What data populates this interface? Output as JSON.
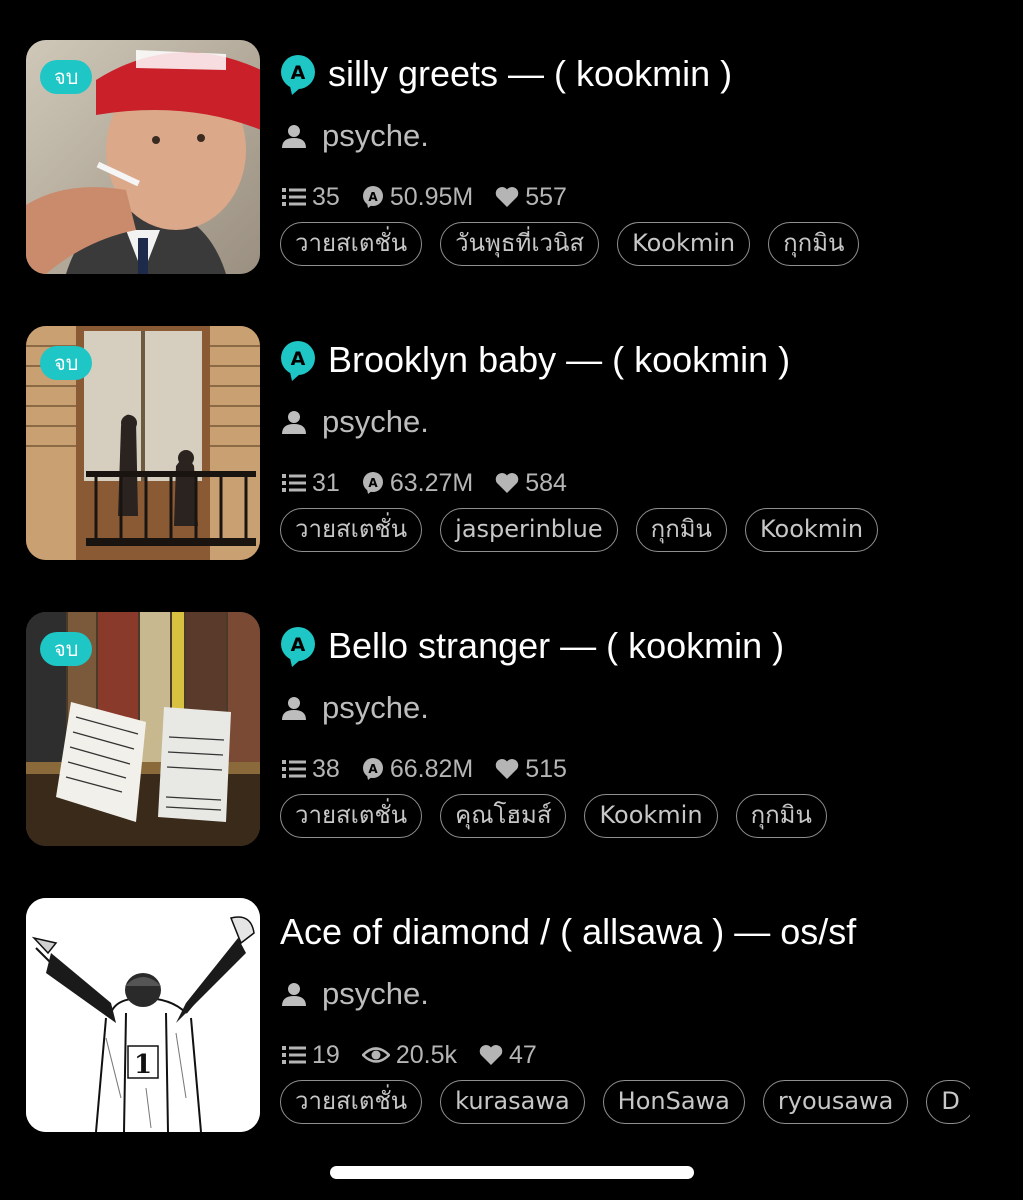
{
  "stories": [
    {
      "badge": "จบ",
      "title": "silly greets — ( kookmin )",
      "author": "psyche.",
      "chapters": "35",
      "reads": "50.95M",
      "likes": "557",
      "tags": [
        "วายสเตชั่น",
        "วันพุธที่เวนิส",
        "Kookmin",
        "กุกมิน"
      ]
    },
    {
      "badge": "จบ",
      "title": "Brooklyn baby — ( kookmin )",
      "author": "psyche.",
      "chapters": "31",
      "reads": "63.27M",
      "likes": "584",
      "tags": [
        "วายสเตชั่น",
        "jasperinblue",
        "กุกมิน",
        "Kookmin"
      ]
    },
    {
      "badge": "จบ",
      "title": "Bello stranger — ( kookmin )",
      "author": "psyche.",
      "chapters": "38",
      "reads": "66.82M",
      "likes": "515",
      "tags": [
        "วายสเตชั่น",
        "คุณโฮมส์",
        "Kookmin",
        "กุกมิน"
      ]
    },
    {
      "title": "Ace of diamond / ( allsawa ) — os/sf",
      "author": "psyche.",
      "chapters": "19",
      "views": "20.5k",
      "likes": "47",
      "tags": [
        "วายสเตชั่น",
        "kurasawa",
        "HonSawa",
        "ryousawa",
        "D"
      ]
    }
  ],
  "colors": {
    "accent": "#1ec6c6",
    "background": "#000000",
    "secondary_text": "#b5b5b5"
  }
}
